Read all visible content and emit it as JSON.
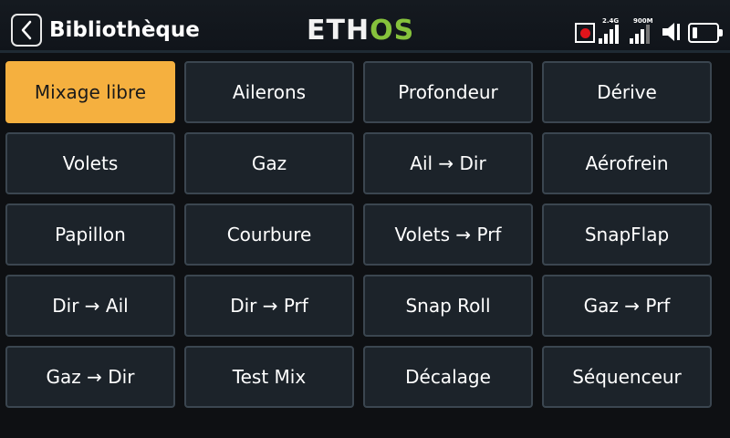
{
  "header": {
    "title": "Bibliothèque",
    "logo_left": "ETH",
    "logo_right": "OS",
    "back_icon": "chevron-left-icon"
  },
  "status": {
    "rf1_label": "2.4G",
    "rf1_level": 4,
    "rf2_label": "900M",
    "rf2_level": 3,
    "recording": true,
    "battery_level": 0.2
  },
  "colors": {
    "accent": "#f5b03f",
    "logo_green": "#86c23c",
    "tile_bg": "#1c232a",
    "tile_border": "#3b4650",
    "record_red": "#e0141b"
  },
  "library": {
    "selected": "Mixage libre",
    "items": [
      "Mixage libre",
      "Ailerons",
      "Profondeur",
      "Dérive",
      "Volets",
      "Gaz",
      "Ail → Dir",
      "Aérofrein",
      "Papillon",
      "Courbure",
      "Volets → Prf",
      "SnapFlap",
      "Dir → Ail",
      "Dir → Prf",
      "Snap Roll",
      "Gaz → Prf",
      "Gaz → Dir",
      "Test Mix",
      "Décalage",
      "Séquenceur"
    ]
  }
}
